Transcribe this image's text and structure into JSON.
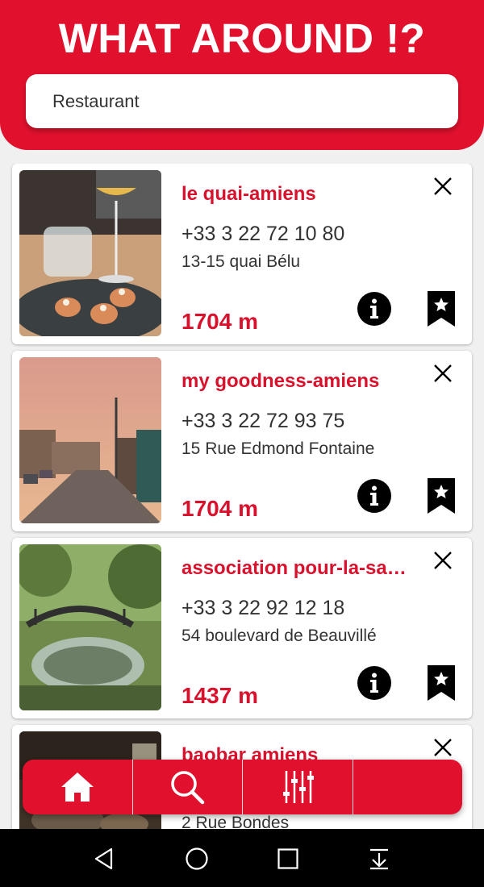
{
  "app": {
    "title": "WHAT AROUND !?"
  },
  "search": {
    "value": "Restaurant"
  },
  "colors": {
    "brand_red": "#e1112d",
    "text_red": "#d8112d",
    "text_dark": "#333333"
  },
  "places": [
    {
      "name": "le quai-amiens",
      "phone": "+33 3 22 72 10 80",
      "address": "13-15 quai Bélu",
      "distance": "1704 m",
      "photo": "cocktail-and-appetizers-photo"
    },
    {
      "name": "my goodness-amiens",
      "phone": "+33 3 22 72 93 75",
      "address": "15 Rue Edmond Fontaine",
      "distance": "1704 m",
      "photo": "street-at-sunset-photo"
    },
    {
      "name": "association pour-la-sa…",
      "phone": "+33 3 22 92 12 18",
      "address": "54 boulevard de Beauvillé",
      "distance": "1437 m",
      "photo": "bridge-over-canal-photo"
    },
    {
      "name": "baobar amiens",
      "phone": "",
      "address": "2 Rue Bondes",
      "distance": "",
      "photo": "restaurant-table-photo"
    }
  ],
  "bottom_nav": {
    "items": [
      {
        "icon": "home-icon"
      },
      {
        "icon": "search-icon"
      },
      {
        "icon": "sliders-icon"
      },
      {
        "icon": "empty"
      }
    ]
  },
  "system_nav": {
    "icons": [
      "back-icon",
      "home-circle-icon",
      "recents-icon",
      "notification-pull-icon"
    ]
  }
}
